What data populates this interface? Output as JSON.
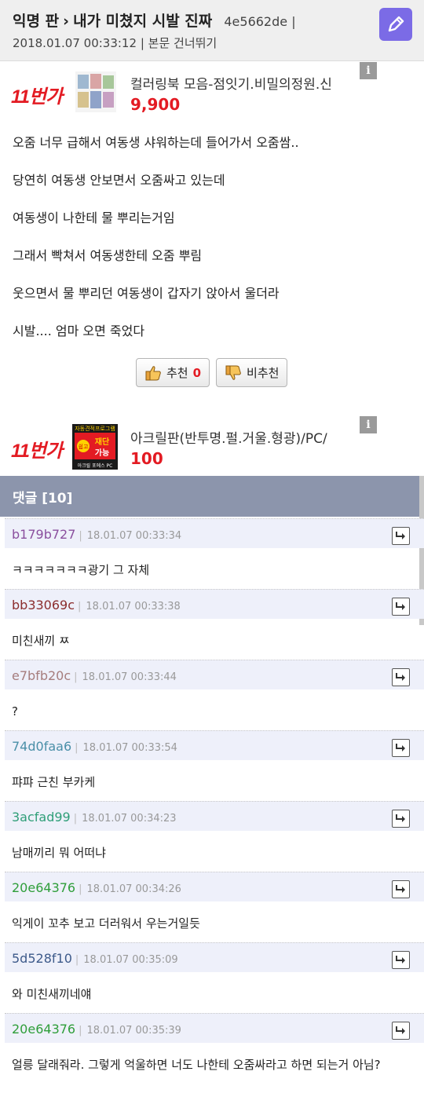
{
  "header": {
    "board": "익명 판",
    "separator": "›",
    "title": "내가 미쳤지 시발 진짜",
    "author_id": "4e5662de |",
    "datetime": "2018.01.07 00:33:12",
    "meta_sep": "|",
    "skip_link": "본문 건너뛰기",
    "write_icon": "pencil-icon"
  },
  "ads": [
    {
      "brand": "11번가",
      "text": "컬러링북 모음-점잇기.비밀의정원.신",
      "price": "9,900",
      "info": "i"
    },
    {
      "brand": "11번가",
      "text": "아크릴판(반투명.펄.거울.형광)/PC/",
      "price": "100",
      "info": "i",
      "thumb_lines": [
        "자동견적프로그램",
        "쉽고",
        "재단",
        "가능",
        "아크릴 포에스 PC"
      ]
    }
  ],
  "post": {
    "paragraphs": [
      "오줌 너무 급해서 여동생 샤워하는데 들어가서 오줌쌈..",
      "당연히 여동생 안보면서 오줌싸고 있는데",
      "여동생이 나한테 물 뿌리는거임",
      "그래서 빡쳐서 여동생한테 오줌 뿌림",
      "웃으면서 물 뿌리던 여동생이 갑자기 앉아서 울더라",
      "시발.... 엄마 오면 죽었다"
    ],
    "upvote_label": "추천",
    "upvote_count": "0",
    "downvote_label": "비추천"
  },
  "comments_header": "댓글 [10]",
  "comments": [
    {
      "user": "b179b727",
      "color": "#8a4f9e",
      "time": "18.01.07 00:33:34",
      "text": "ㅋㅋㅋㅋㅋㅋㅋ광기 그 자체"
    },
    {
      "user": "bb33069c",
      "color": "#8b2d2d",
      "time": "18.01.07 00:33:38",
      "text": "미친새끼 ㅉ"
    },
    {
      "user": "e7bfb20c",
      "color": "#a67d7d",
      "time": "18.01.07 00:33:44",
      "text": "?"
    },
    {
      "user": "74d0faa6",
      "color": "#4a8fa8",
      "time": "18.01.07 00:33:54",
      "text": "퍄퍄 근친 부카케"
    },
    {
      "user": "3acfad99",
      "color": "#2f9e78",
      "time": "18.01.07 00:34:23",
      "text": "남매끼리 뭐 어떠냐"
    },
    {
      "user": "20e64376",
      "color": "#2f9e3a",
      "time": "18.01.07 00:34:26",
      "text": "익게이 꼬추 보고 더러워서 우는거일듯"
    },
    {
      "user": "5d528f10",
      "color": "#3d5a8a",
      "time": "18.01.07 00:35:09",
      "text": "와 미친새끼네얘"
    },
    {
      "user": "20e64376",
      "color": "#2f9e3a",
      "time": "18.01.07 00:35:39",
      "text": "얼릉 달래줘라. 그렇게 억울하면 너도 나한테 오줌싸라고 하면 되는거 아님?"
    }
  ]
}
